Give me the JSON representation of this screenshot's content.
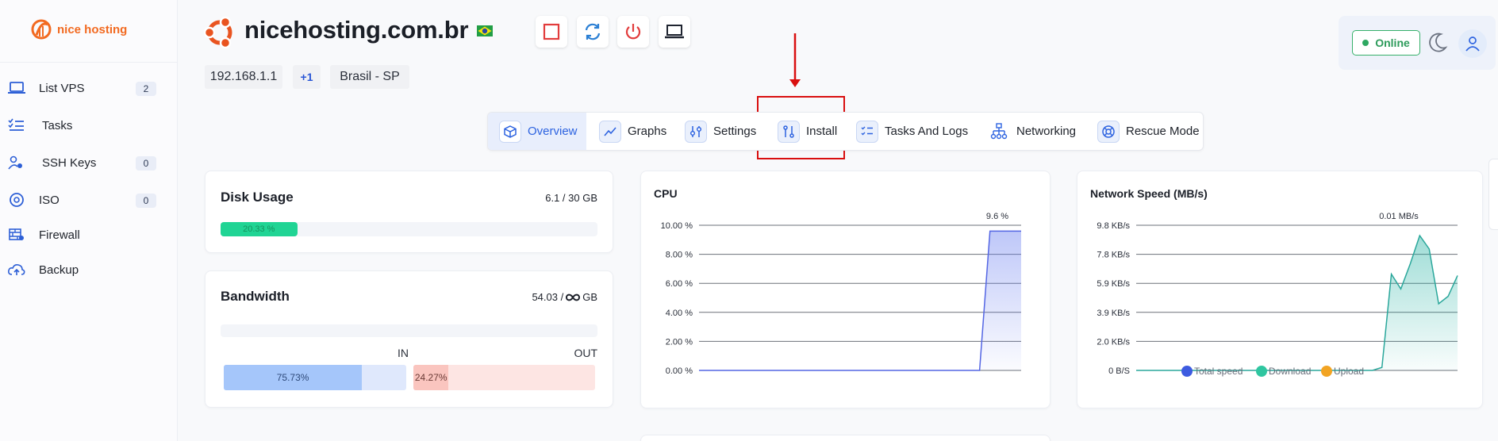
{
  "brand": {
    "logo_text": "nice hosting",
    "accent": "#f26a21"
  },
  "sidebar": {
    "items": [
      {
        "label": "List VPS",
        "badge": "2",
        "icon": "laptop-icon"
      },
      {
        "label": "Tasks",
        "badge": null,
        "icon": "tasks-icon"
      },
      {
        "label": "SSH Keys",
        "badge": "0",
        "icon": "key-user-icon"
      },
      {
        "label": "ISO",
        "badge": "0",
        "icon": "disc-icon"
      },
      {
        "label": "Firewall",
        "badge": null,
        "icon": "firewall-icon"
      },
      {
        "label": "Backup",
        "badge": null,
        "icon": "cloud-upload-icon"
      }
    ]
  },
  "header": {
    "hostname": "nicehosting.com.br",
    "os_icon": "ubuntu-icon",
    "flag": "brazil-flag-icon",
    "actions": [
      {
        "name": "stop-button",
        "icon": "stop-icon"
      },
      {
        "name": "restart-button",
        "icon": "refresh-icon"
      },
      {
        "name": "power-button",
        "icon": "power-icon"
      },
      {
        "name": "console-button",
        "icon": "laptop-icon"
      }
    ],
    "ip": "192.168.1.1",
    "extra_ips": "+1",
    "location": "Brasil - SP"
  },
  "status": {
    "label": "Online",
    "color": "#2ea861"
  },
  "tabs": [
    {
      "label": "Overview",
      "active": true,
      "icon": "box-icon"
    },
    {
      "label": "Graphs",
      "active": false,
      "icon": "chart-line-icon"
    },
    {
      "label": "Settings",
      "active": false,
      "icon": "sliders-icon"
    },
    {
      "label": "Install",
      "active": false,
      "icon": "git-compare-icon"
    },
    {
      "label": "Tasks And Logs",
      "active": false,
      "icon": "list-check-icon"
    },
    {
      "label": "Networking",
      "active": false,
      "icon": "network-icon"
    },
    {
      "label": "Rescue Mode",
      "active": false,
      "icon": "lifebuoy-icon"
    }
  ],
  "disk": {
    "title": "Disk Usage",
    "value": "6.1 / 30 GB",
    "percent_label": "20.33 %",
    "percent": 20.33
  },
  "bandwidth": {
    "title": "Bandwidth",
    "value": "54.03 / ",
    "unit": "GB",
    "in_label": "IN",
    "out_label": "OUT",
    "in_percent_label": "75.73%",
    "in_percent": 75.73,
    "out_percent_label": "24.27%",
    "out_percent": 24.27
  },
  "cpu": {
    "title": "CPU",
    "chart_data": {
      "type": "area",
      "y_ticks": [
        "10.00 %",
        "8.00 %",
        "6.00 %",
        "4.00 %",
        "2.00 %",
        "0.00 %"
      ],
      "ylim": [
        0,
        10
      ],
      "current_label": "9.6 %",
      "values": [
        0,
        0,
        0,
        0,
        0,
        0,
        0,
        0,
        0,
        0,
        0,
        0,
        0,
        0,
        0,
        0,
        0,
        0,
        0,
        0,
        0,
        0,
        0,
        0,
        0,
        0,
        0,
        0,
        9.6,
        9.6,
        9.6,
        9.6
      ]
    }
  },
  "network": {
    "title": "Network Speed (MB/s)",
    "chart_data": {
      "type": "area",
      "y_ticks": [
        "9.8 KB/s",
        "7.8 KB/s",
        "5.9 KB/s",
        "3.9 KB/s",
        "2.0 KB/s",
        "0 B/S"
      ],
      "ylim": [
        0,
        9.8
      ],
      "current_label": "0.01 MB/s",
      "series": [
        {
          "name": "Total speed",
          "color": "#3d5be0"
        },
        {
          "name": "Download",
          "color": "#2fc6a0"
        },
        {
          "name": "Upload",
          "color": "#f2a423"
        }
      ],
      "values": [
        0,
        0,
        0,
        0,
        0,
        0,
        0,
        0,
        0,
        0,
        0,
        0,
        0,
        0,
        0,
        0,
        0,
        0,
        0,
        0,
        0,
        0,
        0,
        0,
        0,
        0,
        0.2,
        6.5,
        5.5,
        7.2,
        9.1,
        8.2,
        4.5,
        5.0,
        6.4
      ]
    }
  }
}
